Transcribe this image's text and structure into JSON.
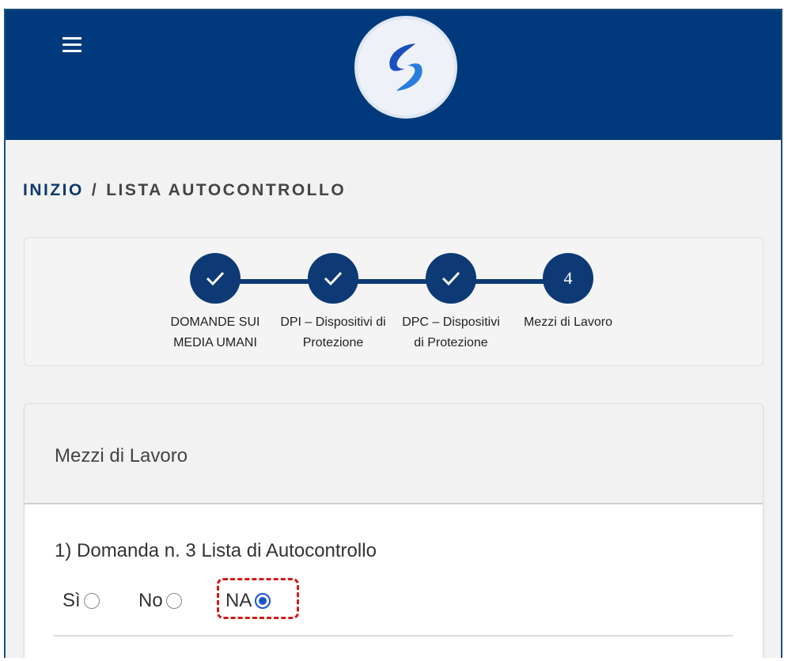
{
  "header": {
    "menu_icon": "hamburger-menu-icon",
    "logo_icon": "swirl-s-logo",
    "brand_color": "#003a7c"
  },
  "breadcrumb": {
    "home": "INIZIO",
    "separator": "/",
    "current": "LISTA AUTOCONTROLLO"
  },
  "stepper": {
    "accent_color": "#0d3a74",
    "steps": [
      {
        "label": "DOMANDE SUI MEDIA UMANI",
        "state": "completed",
        "icon": "check-icon"
      },
      {
        "label": "DPI – Dispositivi di Protezione",
        "state": "completed",
        "icon": "check-icon"
      },
      {
        "label": "DPC – Dispositivi di Protezione",
        "state": "completed",
        "icon": "check-icon"
      },
      {
        "label": "Mezzi di Lavoro",
        "state": "current",
        "number": "4"
      }
    ]
  },
  "section": {
    "title": "Mezzi di Lavoro",
    "question": "1) Domanda n. 3 Lista di Autocontrollo",
    "options": [
      {
        "label": "Sì",
        "checked": false
      },
      {
        "label": "No",
        "checked": false
      },
      {
        "label": "NA",
        "checked": true
      }
    ],
    "highlight_color": "#d11a1a"
  }
}
